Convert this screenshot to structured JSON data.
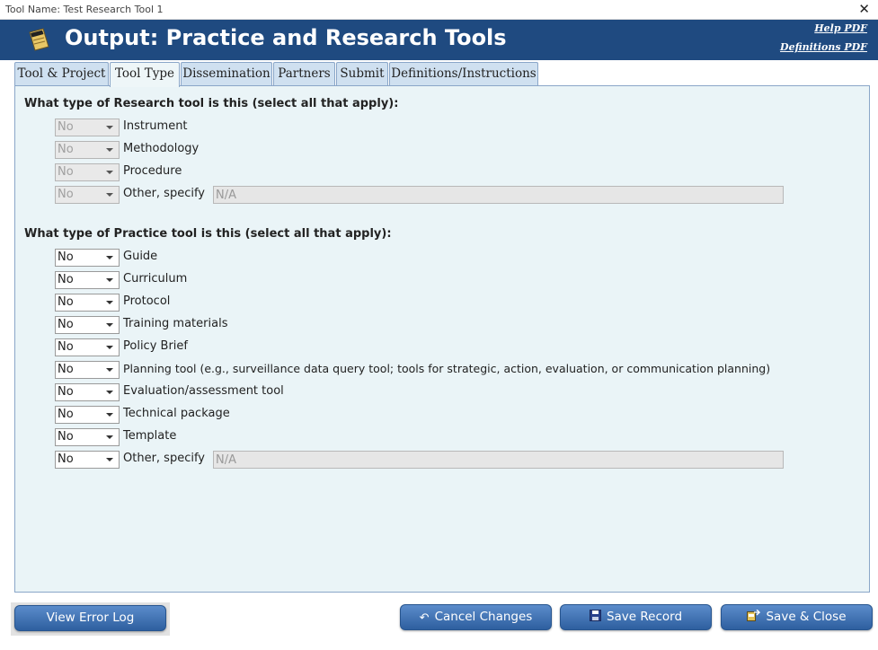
{
  "window": {
    "title": "Tool Name: Test Research Tool 1",
    "close_glyph": "✕"
  },
  "header": {
    "title": "Output: Practice and Research Tools",
    "logo_icon": "notepad-icon",
    "help_link": "Help PDF",
    "definitions_link": "Definitions PDF",
    "background": "#1f4a80"
  },
  "tabs": [
    {
      "label": "Tool & Project",
      "active": false
    },
    {
      "label": "Tool Type",
      "active": true
    },
    {
      "label": "Dissemination",
      "active": false
    },
    {
      "label": "Partners",
      "active": false
    },
    {
      "label": "Submit",
      "active": false
    },
    {
      "label": "Definitions/Instructions",
      "active": false
    }
  ],
  "research": {
    "heading": "What type of Research tool is this (select all that apply):",
    "items": [
      {
        "label": "Instrument",
        "value": "No",
        "disabled": true
      },
      {
        "label": "Methodology",
        "value": "No",
        "disabled": true
      },
      {
        "label": "Procedure",
        "value": "No",
        "disabled": true
      },
      {
        "label": "Other, specify",
        "value": "No",
        "disabled": true,
        "specify": "N/A"
      }
    ]
  },
  "practice": {
    "heading": "What type of Practice tool is this (select all that apply):",
    "items": [
      {
        "label": "Guide",
        "value": "No"
      },
      {
        "label": "Curriculum",
        "value": "No"
      },
      {
        "label": "Protocol",
        "value": "No"
      },
      {
        "label": "Training materials",
        "value": "No"
      },
      {
        "label": "Policy Brief",
        "value": "No"
      },
      {
        "label": "Planning tool (e.g., surveillance data query tool; tools for strategic, action, evaluation, or communication planning)",
        "value": "No"
      },
      {
        "label": "Evaluation/assessment tool",
        "value": "No"
      },
      {
        "label": "Technical package",
        "value": "No"
      },
      {
        "label": "Template",
        "value": "No"
      },
      {
        "label": "Other, specify",
        "value": "No",
        "specify": "N/A"
      }
    ]
  },
  "buttons": {
    "error_log": "View Error Log",
    "cancel": "Cancel Changes",
    "save": "Save Record",
    "save_close": "Save & Close"
  }
}
